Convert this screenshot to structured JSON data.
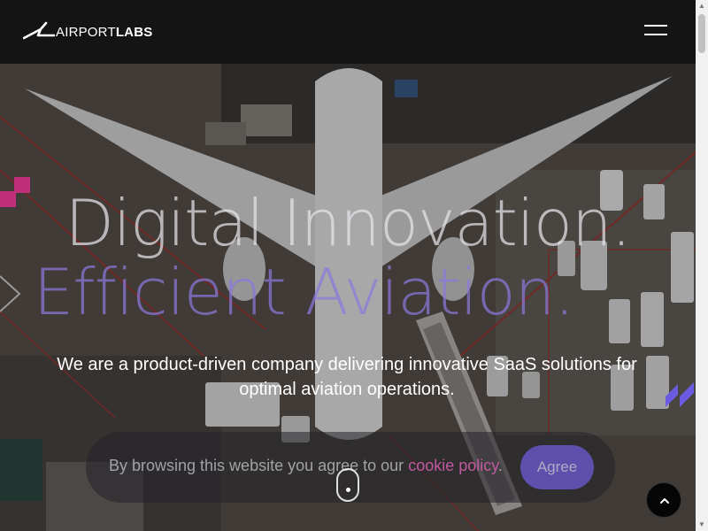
{
  "header": {
    "logo_light": "AIRPORT",
    "logo_bold": "LABS",
    "menu_icon": "hamburger-menu-icon"
  },
  "hero": {
    "headline_line1": "Digital Innovation.",
    "headline_line2": "Efficient Aviation.",
    "subtext": "We are a product-driven company delivering innovative SaaS solutions for optimal aviation operations."
  },
  "cookie_banner": {
    "text_before": "By browsing this website you agree to our ",
    "link_text": "cookie policy",
    "text_after": ".",
    "agree_label": "Agree"
  },
  "icons": {
    "scroll_indicator": "mouse-scroll-icon",
    "back_to_top": "chevron-up-icon"
  },
  "colors": {
    "header_bg": "#141414",
    "headline_secondary": "#8c78dc",
    "cookie_link": "#c05aa0",
    "agree_button": "#6f5bd8",
    "brand_pink": "#c0307a",
    "brand_violet": "#6b5be0"
  }
}
